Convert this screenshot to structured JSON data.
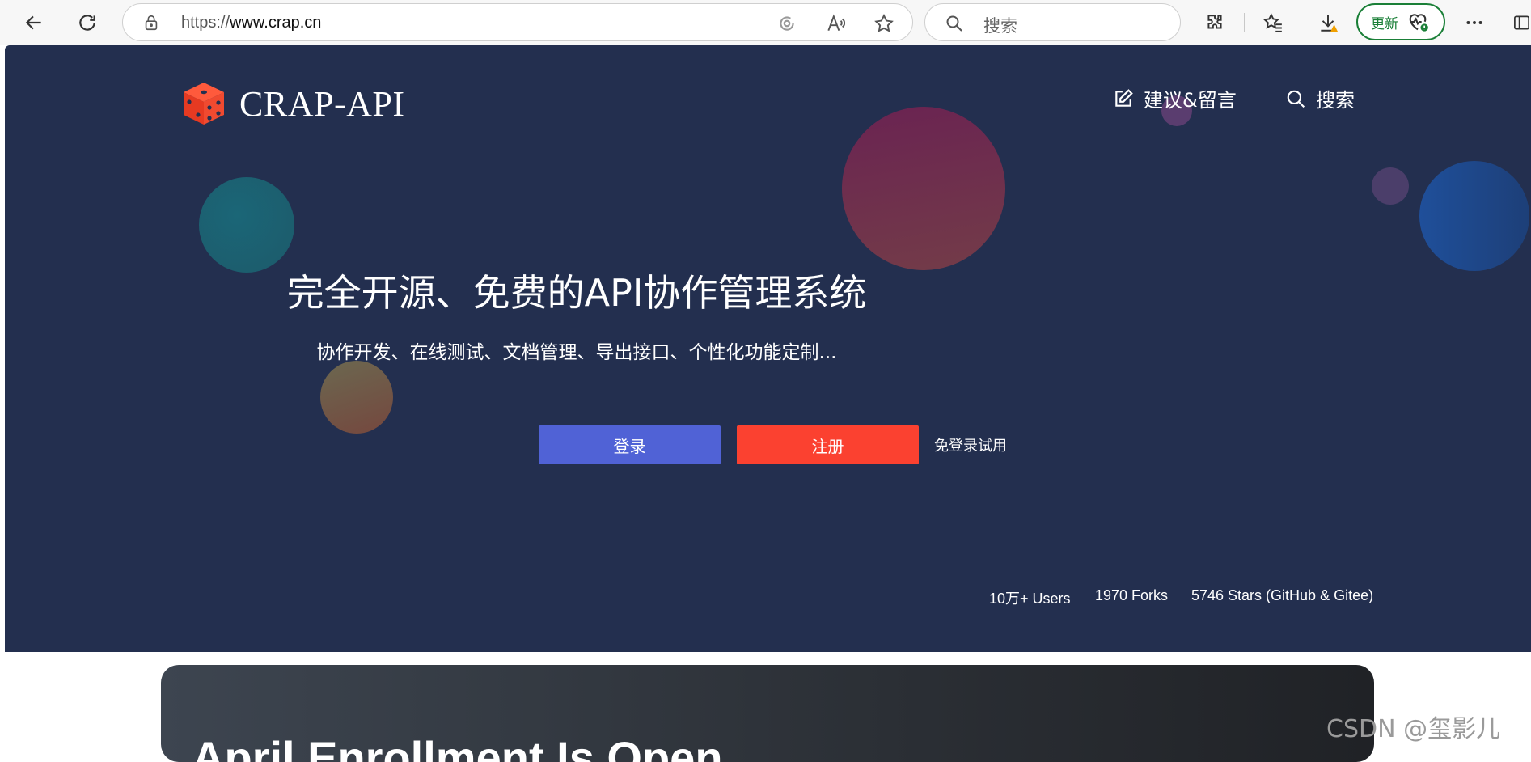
{
  "browser": {
    "url_scheme": "https://",
    "url_host": "www.crap.cn",
    "search_placeholder": "搜索",
    "update_label": "更新",
    "icons": [
      "back-icon",
      "refresh-icon",
      "lock-icon",
      "tracking-icon",
      "read-aloud-icon",
      "favorite-star-icon",
      "search-icon",
      "extensions-icon",
      "favorites-icon",
      "downloads-icon",
      "health-icon",
      "more-icon",
      "sidebar-icon"
    ]
  },
  "site": {
    "logo_text": "CRAP-API",
    "nav": {
      "feedback": "建议&留言",
      "search": "搜索"
    },
    "hero": {
      "title": "完全开源、免费的API协作管理系统",
      "subtitle": "协作开发、在线测试、文档管理、导出接口、个性化功能定制..."
    },
    "buttons": {
      "login": "登录",
      "register": "注册",
      "try": "免登录试用"
    },
    "stats": {
      "users": "10万+ Users",
      "forks": "1970 Forks",
      "stars": "5746 Stars (GitHub & Gitee)"
    }
  },
  "banner": {
    "title": "April Enrollment Is Open"
  },
  "watermark": "CSDN @玺影儿",
  "colors": {
    "hero_bg": "#232f4f",
    "login_btn": "#5062d6",
    "register_btn": "#fb4130",
    "logo_red": "#f5422c",
    "update_green": "#1a7f37"
  }
}
